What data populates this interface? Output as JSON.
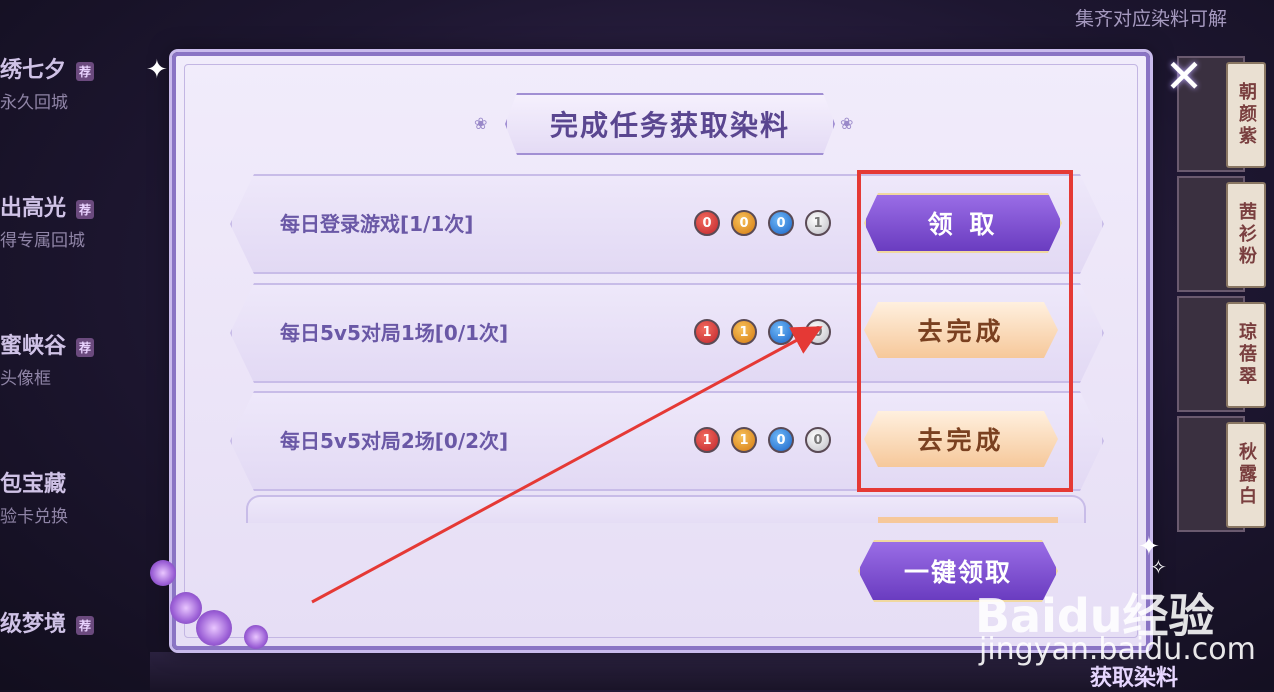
{
  "background": {
    "left_menu": [
      {
        "title": "绣七夕",
        "badge": "荐",
        "subtitle": "永久回城"
      },
      {
        "title": "出高光",
        "badge": "荐",
        "subtitle": "得专属回城"
      },
      {
        "title": "蜜峡谷",
        "badge": "荐",
        "subtitle": "头像框"
      },
      {
        "title": "包宝藏",
        "badge": "",
        "subtitle": "验卡兑换"
      },
      {
        "title": "级梦境",
        "badge": "荐",
        "subtitle": ""
      }
    ],
    "right_hint": "集齐对应染料可解",
    "dye_tags": [
      "朝颜紫",
      "茜衫粉",
      "琼蓓翠",
      "秋露白"
    ],
    "bottom_title": "获取染料"
  },
  "modal": {
    "title": "完成任务获取染料",
    "tasks": [
      {
        "label": "每日登录游戏[1/1次]",
        "coins": [
          "0",
          "0",
          "0",
          "1"
        ],
        "button": "领 取",
        "button_style": "purple"
      },
      {
        "label": "每日5v5对局1场[0/1次]",
        "coins": [
          "1",
          "1",
          "1",
          "0"
        ],
        "button": "去完成",
        "button_style": "peach"
      },
      {
        "label": "每日5v5对局2场[0/2次]",
        "coins": [
          "1",
          "1",
          "0",
          "0"
        ],
        "button": "去完成",
        "button_style": "peach"
      }
    ],
    "claim_all_label": "一键领取",
    "close_icon": "close-icon"
  },
  "watermark": {
    "logo": "Baidu经验",
    "url": "jingyan.baidu.com"
  },
  "colors": {
    "highlight_box": "#e53935",
    "arrow": "#e53935",
    "modal_border": "#8a74c4",
    "purple_button": "#7b4ad0",
    "peach_button": "#f6c89a"
  }
}
